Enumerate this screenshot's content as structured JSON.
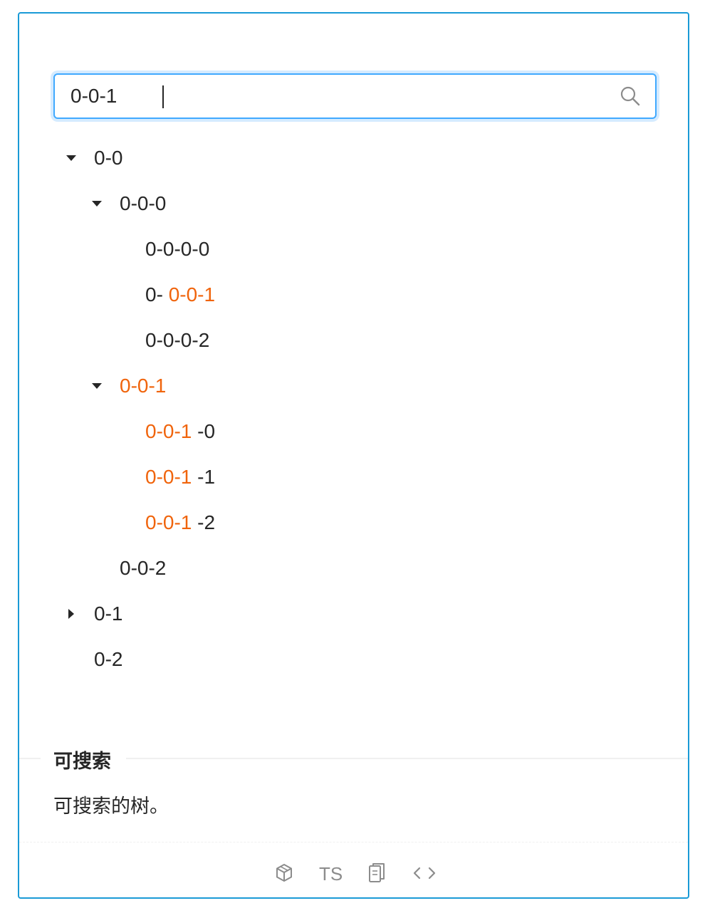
{
  "search": {
    "value": "0-0-1",
    "placeholder": ""
  },
  "tree": {
    "n_0_0": {
      "label": "0-0"
    },
    "n_0_0_0": {
      "label": "0-0-0"
    },
    "n_0_0_0_0": {
      "label": "0-0-0-0"
    },
    "n_0_0_0_1": {
      "prefix": "0-",
      "match": "0-0-1"
    },
    "n_0_0_0_2": {
      "label": "0-0-0-2"
    },
    "n_0_0_1": {
      "match": "0-0-1"
    },
    "n_0_0_1_0": {
      "match": "0-0-1",
      "suffix": "-0"
    },
    "n_0_0_1_1": {
      "match": "0-0-1",
      "suffix": "-1"
    },
    "n_0_0_1_2": {
      "match": "0-0-1",
      "suffix": "-2"
    },
    "n_0_0_2": {
      "label": "0-0-2"
    },
    "n_0_1": {
      "label": "0-1"
    },
    "n_0_2": {
      "label": "0-2"
    }
  },
  "demo": {
    "title": "可搜索",
    "description": "可搜索的树。"
  },
  "actions": {
    "ts_label": "TS"
  },
  "icons": [
    "search-icon",
    "caret-down-icon",
    "caret-right-icon",
    "codesandbox-icon",
    "copy-icon",
    "code-icon"
  ],
  "colors": {
    "border": "#1a9ad6",
    "focus": "#40a9ff",
    "highlight": "#f0640c",
    "text": "#262626",
    "muted": "#8c8c8c"
  }
}
